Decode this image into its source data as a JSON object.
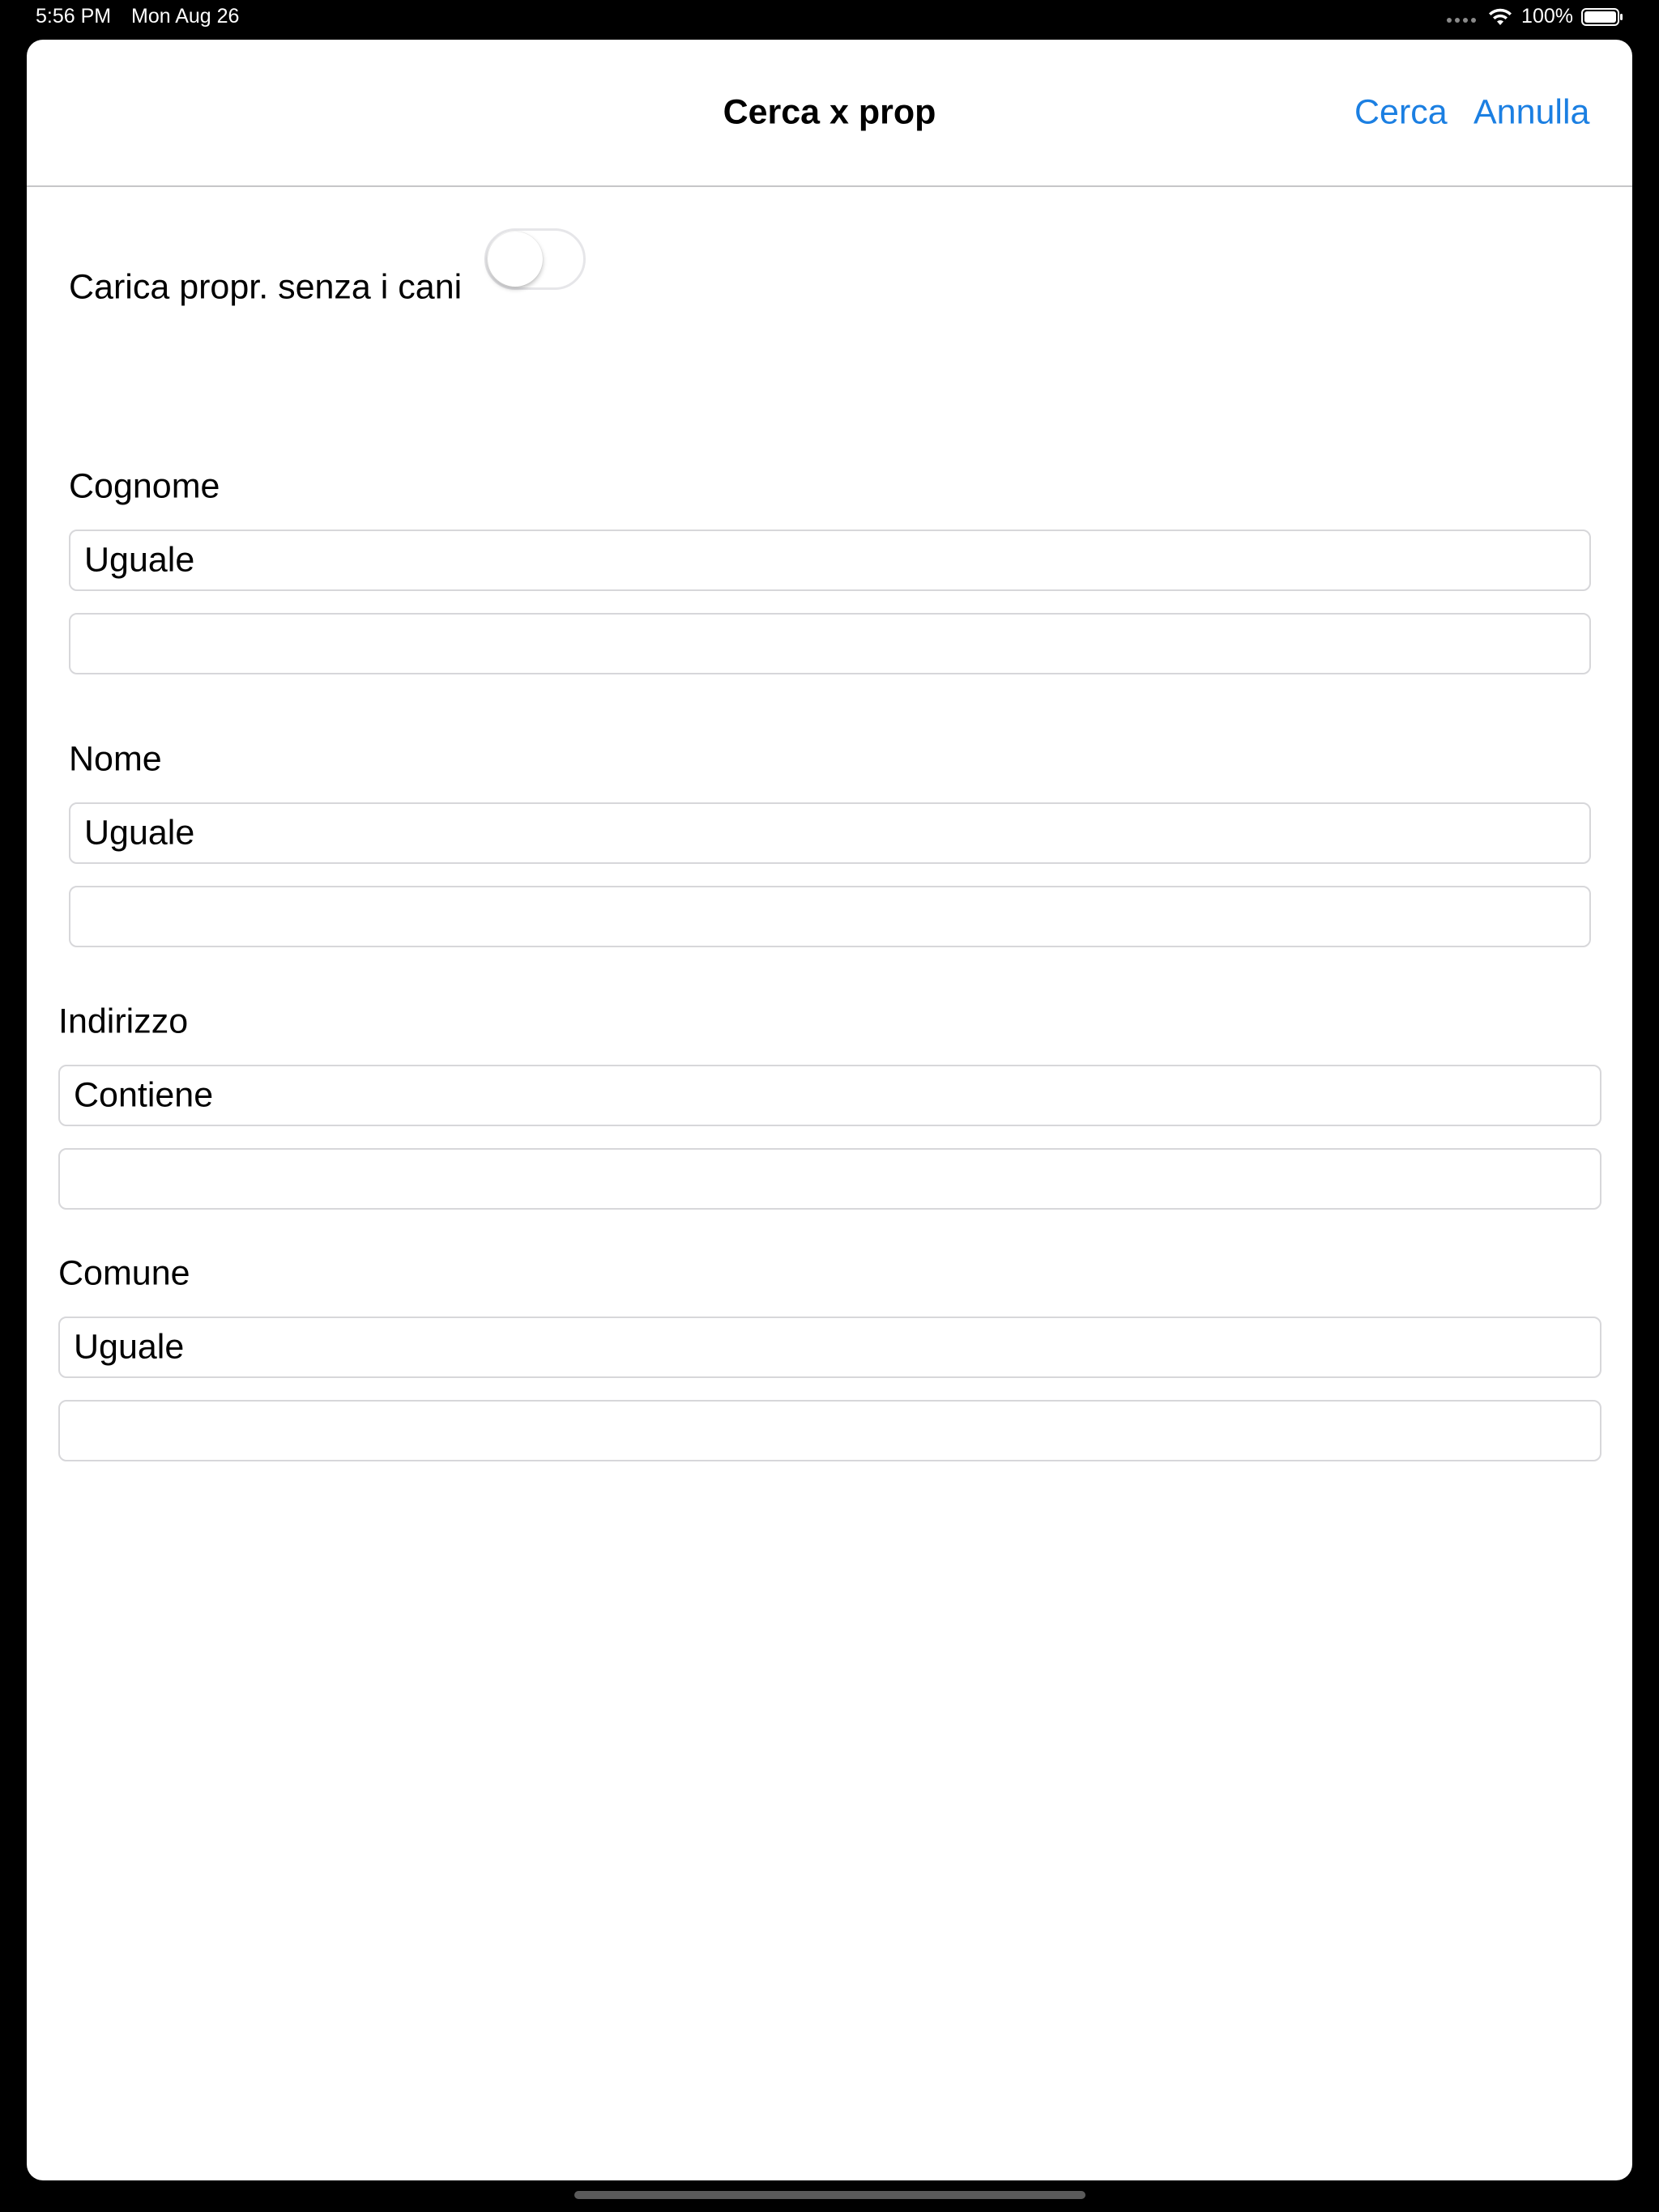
{
  "status_bar": {
    "time": "5:56 PM",
    "date": "Mon Aug 26",
    "battery": "100%"
  },
  "nav": {
    "title": "Cerca x prop",
    "search_label": "Cerca",
    "cancel_label": "Annulla"
  },
  "toggle": {
    "label": "Carica propr. senza i cani",
    "on": false
  },
  "fields": {
    "cognome": {
      "label": "Cognome",
      "mode": "Uguale",
      "value": ""
    },
    "nome": {
      "label": "Nome",
      "mode": "Uguale",
      "value": ""
    },
    "indirizzo": {
      "label": "Indirizzo",
      "mode": "Contiene",
      "value": ""
    },
    "comune": {
      "label": "Comune",
      "mode": "Uguale",
      "value": ""
    }
  },
  "colors": {
    "accent": "#1b7fe2",
    "background": "#000000",
    "sheet": "#ffffff"
  }
}
